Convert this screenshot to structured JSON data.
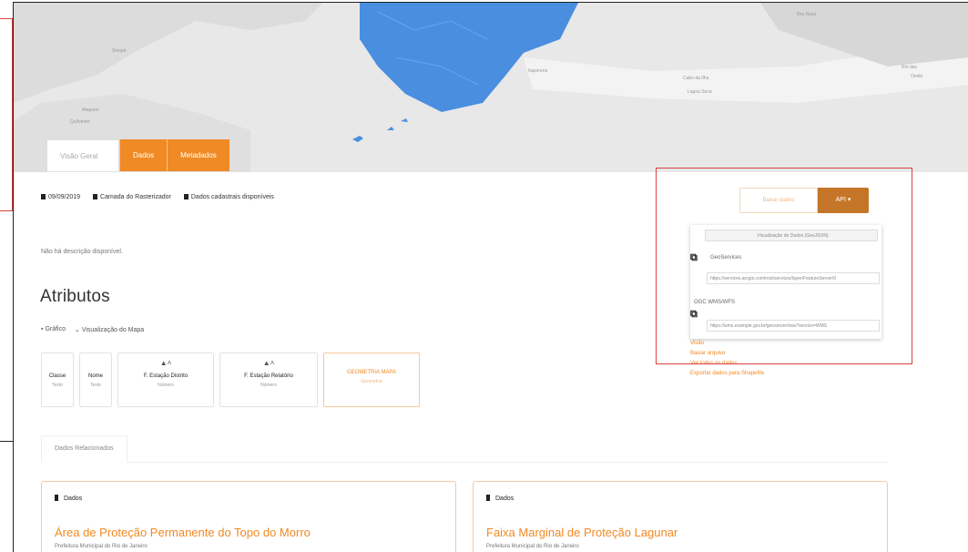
{
  "map": {
    "labels": [
      "Sinopé",
      "Atapaco",
      "Quilombo",
      "Itaperuna",
      "Cabo da Ilha",
      "Lagoa Seca",
      "Rio das",
      "Oeste",
      "Ilha Rasa"
    ]
  },
  "tabs": [
    {
      "label": "Visão Geral",
      "active": true
    },
    {
      "label": "Dados",
      "active": false
    },
    {
      "label": "Metadados",
      "active": false
    }
  ],
  "meta": [
    "09/09/2019",
    "Camada do Rasterizador",
    "Dados cadastrais disponíveis"
  ],
  "description": "Não há descrição disponível.",
  "attributes": {
    "title": "Atributos",
    "options": [
      "Gráfico",
      "Visualização do Mapa"
    ],
    "cards": [
      {
        "name": "Classe",
        "type": "Texto",
        "selected": false,
        "arrow": ""
      },
      {
        "name": "Nome",
        "type": "Texto",
        "selected": false,
        "arrow": ""
      },
      {
        "name": "F. Estação Distrito",
        "type": "Número",
        "selected": false,
        "arrow": "▲˄"
      },
      {
        "name": "F. Estação Relatório",
        "type": "Número",
        "selected": false,
        "arrow": "▲˄"
      },
      {
        "name": "GEOMETRIA MAPA",
        "type": "Geometria",
        "selected": true,
        "arrow": ""
      }
    ]
  },
  "subtab": "Dados Relacionados",
  "results": [
    {
      "head": "Dados",
      "title": "Área de Proteção Permanente do Topo do Morro",
      "sub": "Prefeitura Municipal do Rio de Janeiro"
    },
    {
      "head": "Dados",
      "title": "Faixa Marginal de Proteção Lagunar",
      "sub": "Prefeitura Municipal do Rio de Janeiro"
    }
  ],
  "actions": {
    "secondary": "Baixar dados",
    "primary": "API ▾",
    "dropdown": {
      "header": "Visualização de Dados (GeoJSON)",
      "geoservices_label": "GeoServices",
      "geoservices_url": "https://services.arcgis.com/rest/services/layer/FeatureServer/0",
      "wms_label": "OGC WMS/WFS",
      "wms_url": "https://wms.example.gov.br/geoserver/ows?service=WMS"
    },
    "links": [
      "Visão",
      "Baixar arquivo",
      "Ver todos os dados",
      "Exportar dados para Shapefile"
    ]
  },
  "colors": {
    "accent": "#f08a24",
    "accent_dark": "#c57528",
    "map_water": "#e7e7e7",
    "map_region": "#4a8ee0",
    "highlight": "#d94141"
  }
}
